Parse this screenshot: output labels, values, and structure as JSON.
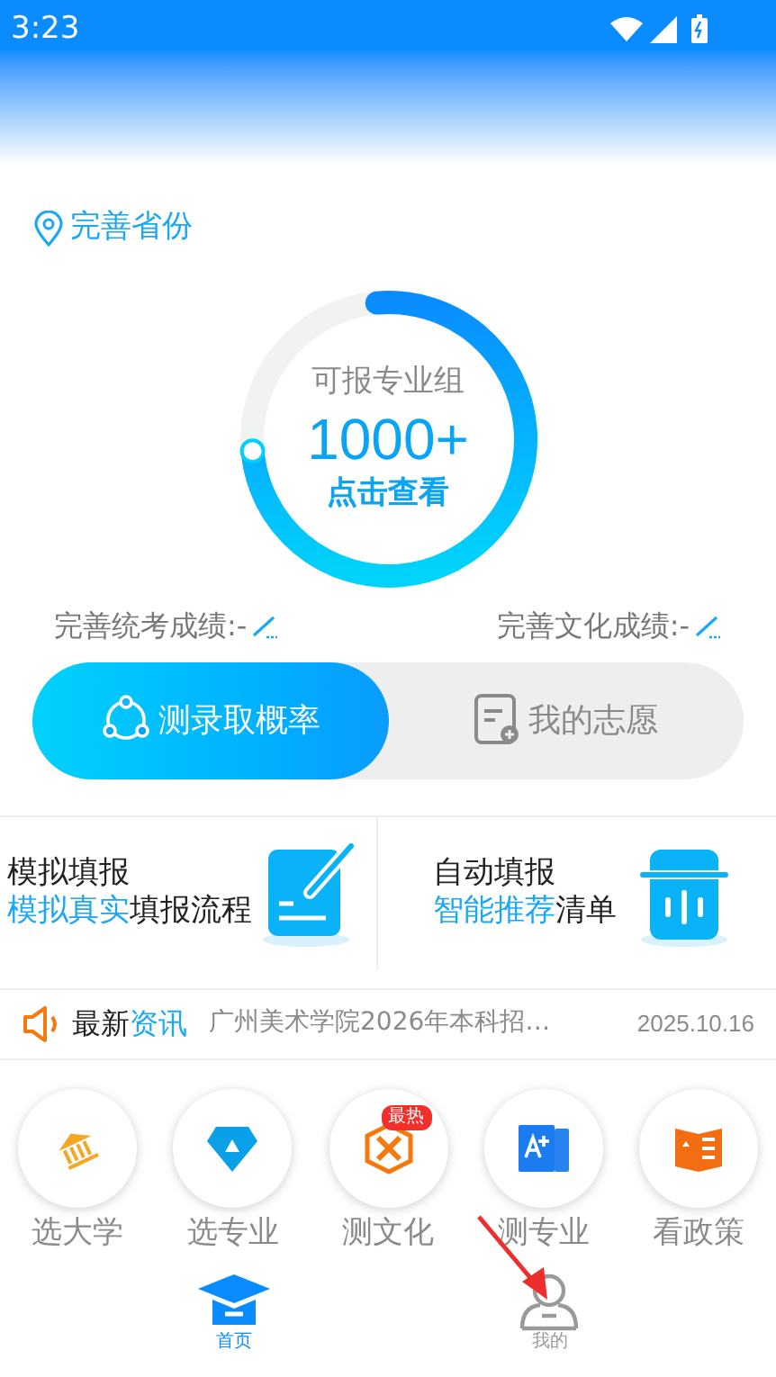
{
  "status_bar": {
    "time": "3:23"
  },
  "location": {
    "label": "完善省份"
  },
  "gauge": {
    "caption": "可报专业组",
    "count": "1000+",
    "action": "点击查看",
    "level": 0.75
  },
  "scores": [
    {
      "label": "完善统考成绩:-"
    },
    {
      "label": "完善文化成绩:-"
    }
  ],
  "tabs": [
    {
      "label": "测录取概率",
      "selected": true,
      "kind": "probability"
    },
    {
      "label": "我的志愿",
      "selected": false,
      "kind": "wishlist"
    }
  ],
  "feature_cards": [
    {
      "title": "模拟填报",
      "highlight": "模拟真实",
      "rest": "填报流程",
      "kind": "simulate"
    },
    {
      "title": "自动填报",
      "highlight": "智能推荐",
      "rest": "清单",
      "kind": "auto"
    }
  ],
  "news": {
    "label": "最新",
    "label_highlight": "资讯",
    "headline": "广州美术学院2026年本科招…",
    "date": "2025.10.16"
  },
  "shortcuts": [
    {
      "label": "选大学",
      "kind": "university"
    },
    {
      "label": "选专业",
      "kind": "major"
    },
    {
      "label": "测文化",
      "kind": "culture",
      "badge": "最热"
    },
    {
      "label": "测专业",
      "kind": "grade"
    },
    {
      "label": "看政策",
      "kind": "policy"
    }
  ],
  "bottom_nav": [
    {
      "label": "首页",
      "selected": true,
      "kind": "home"
    },
    {
      "label": "我的",
      "selected": false,
      "kind": "mine"
    }
  ]
}
